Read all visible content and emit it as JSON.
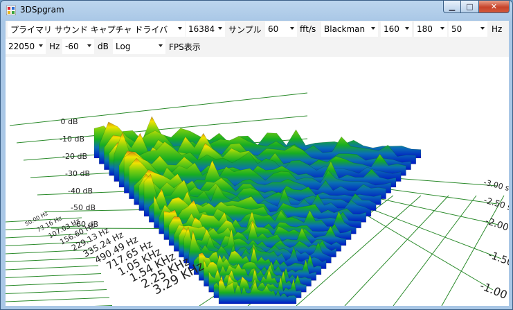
{
  "window": {
    "title": "3DSpgram"
  },
  "toolbar": {
    "device": "プライマリ サウンド キャプチャ ドライバ",
    "fft_size": "16384",
    "samples_label": "サンプル",
    "fft_rate": "60",
    "fft_unit": "fft/s",
    "window_func": "Blackman",
    "val1": "160",
    "val2": "180",
    "val3": "50",
    "hz_label1": "Hz",
    "max_freq": "22050",
    "hz_label2": "Hz",
    "min_db": "-60",
    "db_label": "dB",
    "scale": "Log",
    "fps_label": "FPS表示"
  },
  "plot": {
    "db_labels": [
      "0 dB",
      "-10 dB",
      "-20 dB",
      "-30 dB",
      "-40 dB",
      "-50 dB",
      "-60 dB"
    ],
    "freq_labels": [
      "50.00 Hz",
      "73.16 Hz",
      "107.03 Hz",
      "156.60 Hz",
      "229.13 Hz",
      "335.24 Hz",
      "490.49 Hz",
      "717.65 Hz",
      "1.05 KHz",
      "1.54 KHz",
      "2.25 KHz",
      "3.29 KHz"
    ],
    "time_labels": [
      "-3.00 sec",
      "-2.50 sec",
      "-2.00 sec",
      "-1.50 sec",
      "-1.00 sec"
    ],
    "colors": {
      "low": "#0018c8",
      "mid": "#17b51a",
      "high": "#f1e300",
      "peak": "#d98a12",
      "grid": "#2a8a2a"
    }
  }
}
